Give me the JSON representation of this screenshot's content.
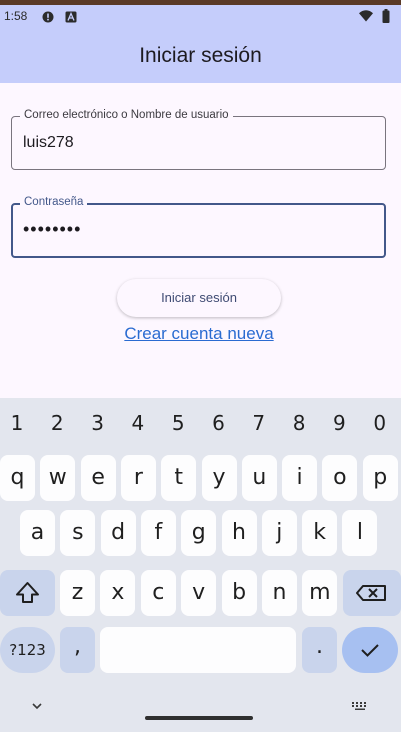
{
  "status_bar": {
    "time": "1:58",
    "icons": [
      "alert-circle-icon",
      "a-notification-icon",
      "wifi-icon",
      "battery-icon"
    ]
  },
  "app_bar": {
    "title": "Iniciar sesión",
    "background": "#c5cdfb"
  },
  "form": {
    "username": {
      "label": "Correo electrónico o Nombre de usuario",
      "value": "luis278"
    },
    "password": {
      "label": "Contraseña",
      "value": "••••••••",
      "focused": true
    },
    "login_button": "Iniciar sesión",
    "create_account_link": "Crear cuenta nueva"
  },
  "keyboard": {
    "number_row": [
      "1",
      "2",
      "3",
      "4",
      "5",
      "6",
      "7",
      "8",
      "9",
      "0"
    ],
    "row1": [
      "q",
      "w",
      "e",
      "r",
      "t",
      "y",
      "u",
      "i",
      "o",
      "p"
    ],
    "row2": [
      "a",
      "s",
      "d",
      "f",
      "g",
      "h",
      "j",
      "k",
      "l"
    ],
    "row3": [
      "z",
      "x",
      "c",
      "v",
      "b",
      "n",
      "m"
    ],
    "symbols_key": "?123",
    "comma_key": ",",
    "period_key": ".",
    "shift_icon": "shift-icon",
    "backspace_icon": "backspace-icon",
    "enter_icon": "checkmark-icon",
    "accent": "#a7c0f1"
  },
  "nav_bar": {
    "icons": [
      "chevron-down-icon",
      "keyboard-icon"
    ]
  }
}
